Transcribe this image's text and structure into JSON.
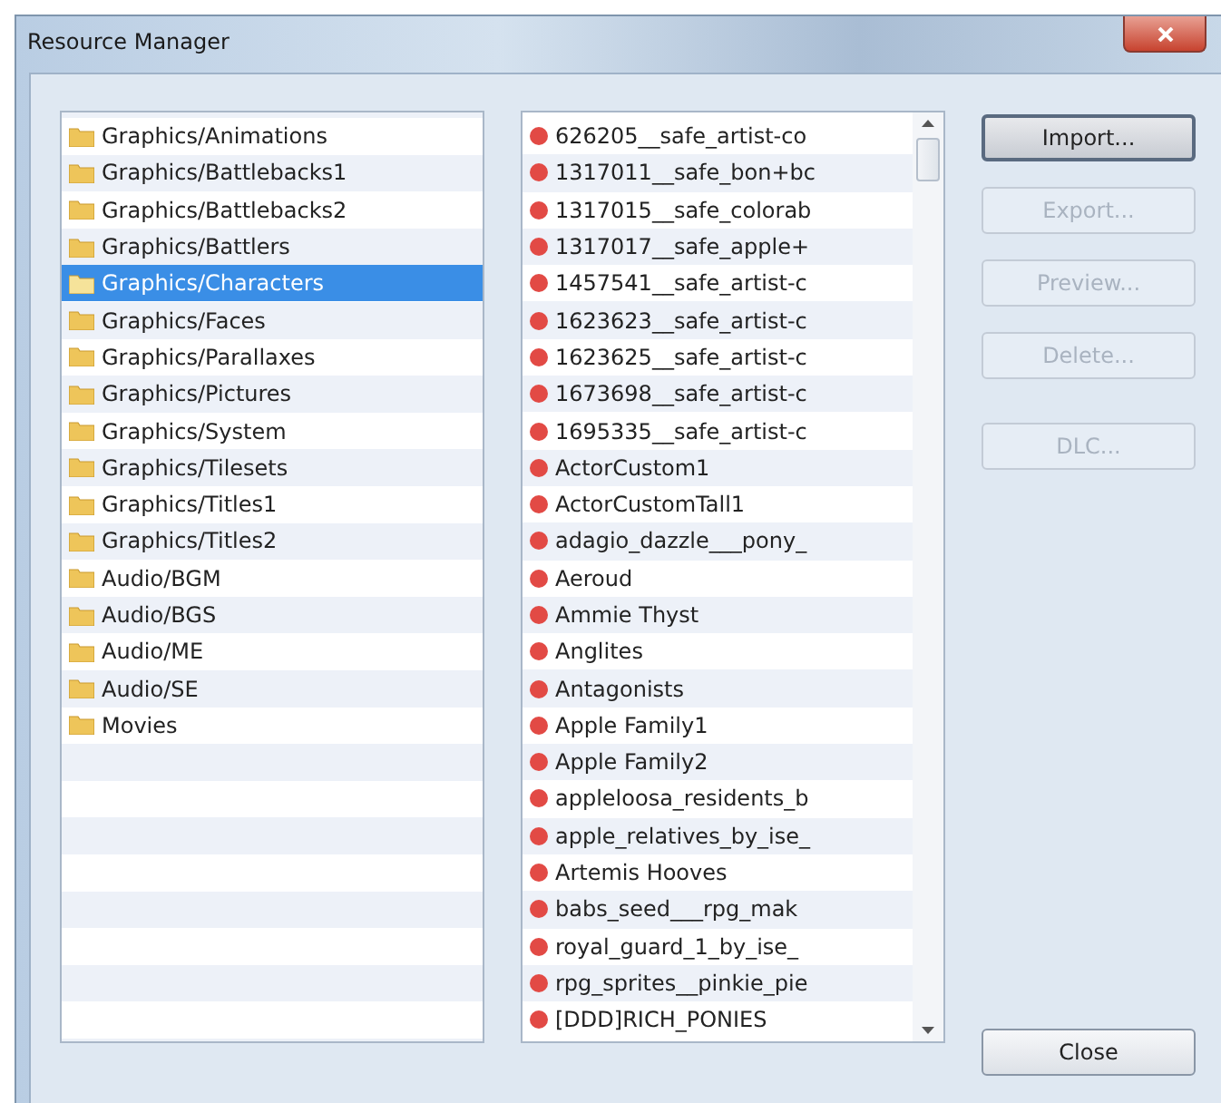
{
  "window": {
    "title": "Resource Manager"
  },
  "folders": [
    {
      "label": "Graphics/Animations",
      "selected": false
    },
    {
      "label": "Graphics/Battlebacks1",
      "selected": false
    },
    {
      "label": "Graphics/Battlebacks2",
      "selected": false
    },
    {
      "label": "Graphics/Battlers",
      "selected": false
    },
    {
      "label": "Graphics/Characters",
      "selected": true
    },
    {
      "label": "Graphics/Faces",
      "selected": false
    },
    {
      "label": "Graphics/Parallaxes",
      "selected": false
    },
    {
      "label": "Graphics/Pictures",
      "selected": false
    },
    {
      "label": "Graphics/System",
      "selected": false
    },
    {
      "label": "Graphics/Tilesets",
      "selected": false
    },
    {
      "label": "Graphics/Titles1",
      "selected": false
    },
    {
      "label": "Graphics/Titles2",
      "selected": false
    },
    {
      "label": "Audio/BGM",
      "selected": false
    },
    {
      "label": "Audio/BGS",
      "selected": false
    },
    {
      "label": "Audio/ME",
      "selected": false
    },
    {
      "label": "Audio/SE",
      "selected": false
    },
    {
      "label": "Movies",
      "selected": false
    }
  ],
  "resources": [
    "626205__safe_artist-co",
    "1317011__safe_bon+bc",
    "1317015__safe_colorab",
    "1317017__safe_apple+",
    "1457541__safe_artist-c",
    "1623623__safe_artist-c",
    "1623625__safe_artist-c",
    "1673698__safe_artist-c",
    "1695335__safe_artist-c",
    "ActorCustom1",
    "ActorCustomTall1",
    "adagio_dazzle___pony_",
    "Aeroud",
    "Ammie Thyst",
    "Anglites",
    "Antagonists",
    "Apple Family1",
    "Apple Family2",
    "appleloosa_residents_b",
    "apple_relatives_by_ise_",
    "Artemis Hooves",
    "babs_seed___rpg_mak",
    "royal_guard_1_by_ise_",
    "rpg_sprites__pinkie_pie",
    "[DDD]RICH_PONIES"
  ],
  "buttons": [
    {
      "label": "Import...",
      "disabled": false,
      "default": true
    },
    {
      "label": "Export...",
      "disabled": true,
      "default": false
    },
    {
      "label": "Preview...",
      "disabled": true,
      "default": false
    },
    {
      "label": "Delete...",
      "disabled": true,
      "default": false
    },
    {
      "label": "DLC...",
      "disabled": true,
      "default": false
    }
  ],
  "close_button": {
    "label": "Close"
  }
}
